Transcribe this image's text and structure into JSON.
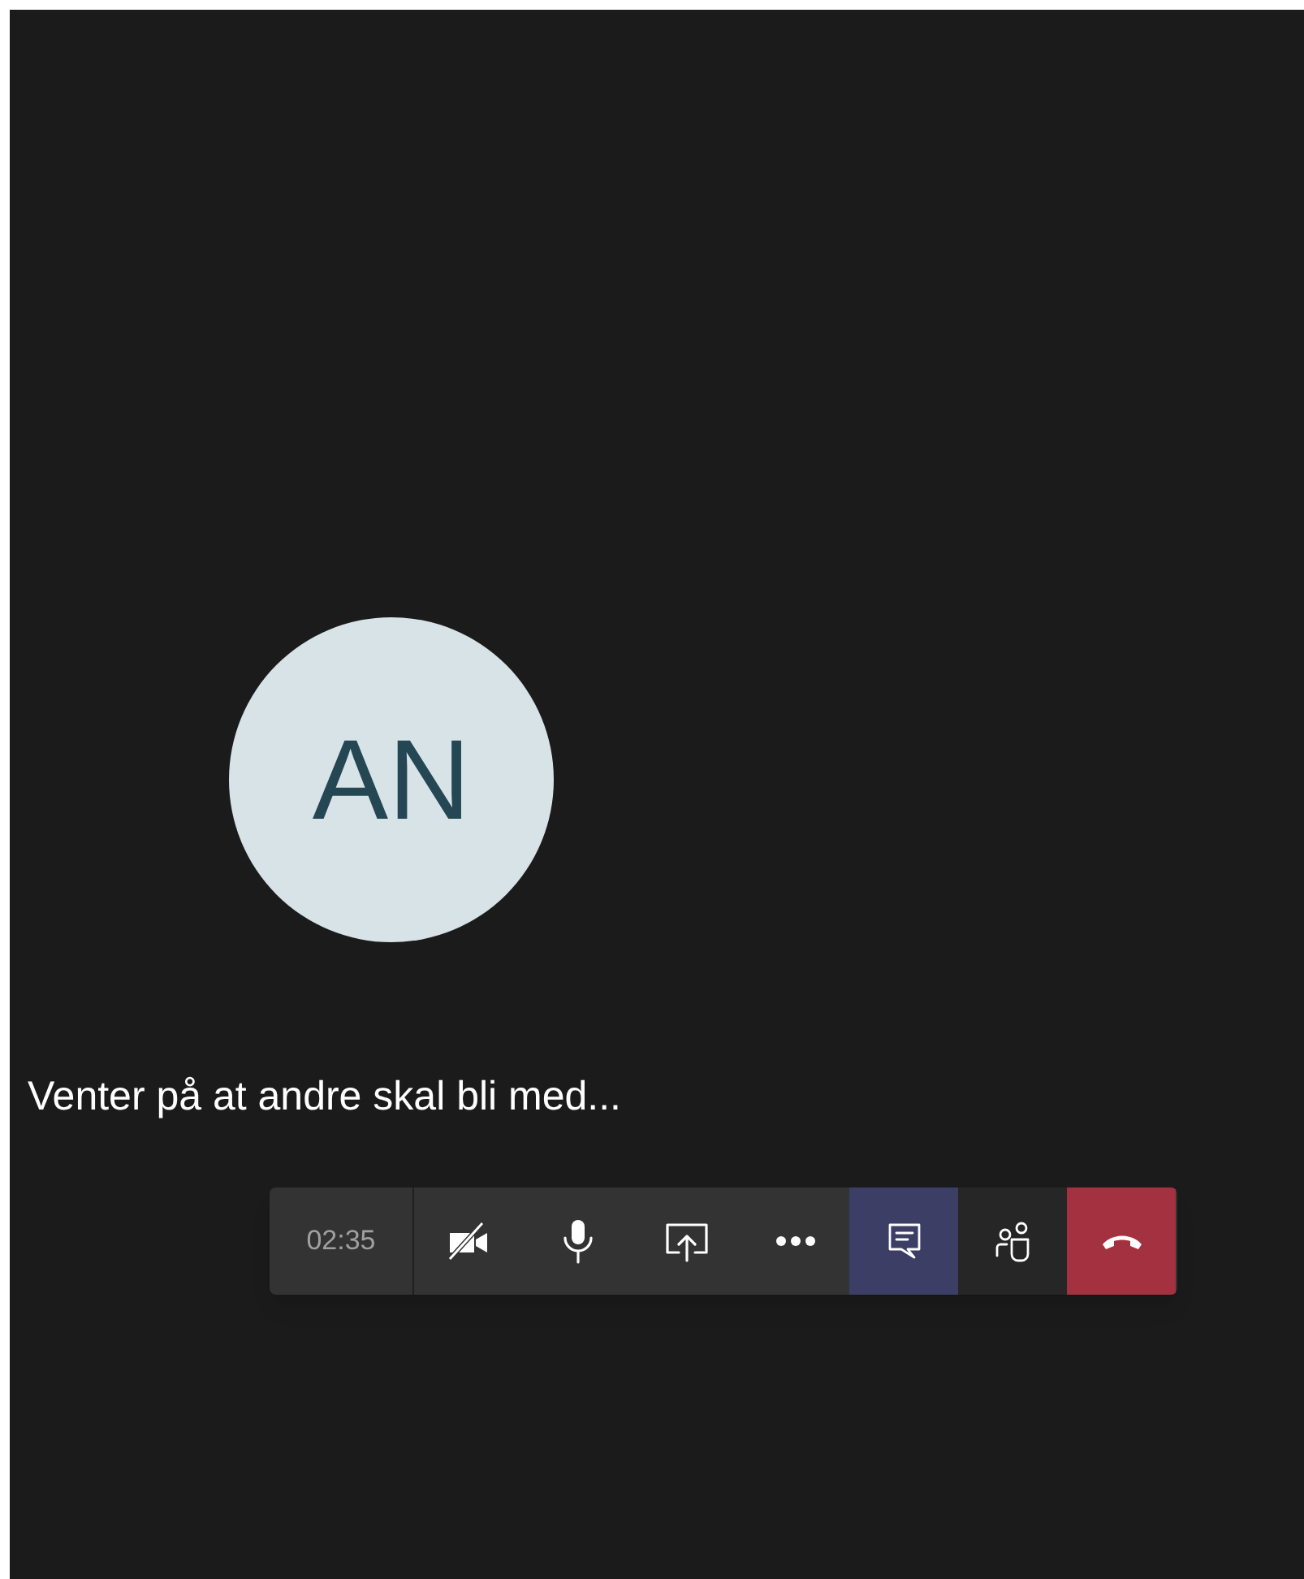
{
  "avatar": {
    "initials": "AN"
  },
  "status": "Venter på at andre skal bli med...",
  "toolbar": {
    "timer": "02:35",
    "buttons": [
      {
        "kind": "camera-off",
        "selected": false
      },
      {
        "kind": "mic",
        "selected": false
      },
      {
        "kind": "share",
        "selected": false
      },
      {
        "kind": "more",
        "selected": false
      },
      {
        "kind": "chat",
        "selected": true
      },
      {
        "kind": "people",
        "selected": false
      },
      {
        "kind": "hangup",
        "selected": false
      }
    ]
  }
}
